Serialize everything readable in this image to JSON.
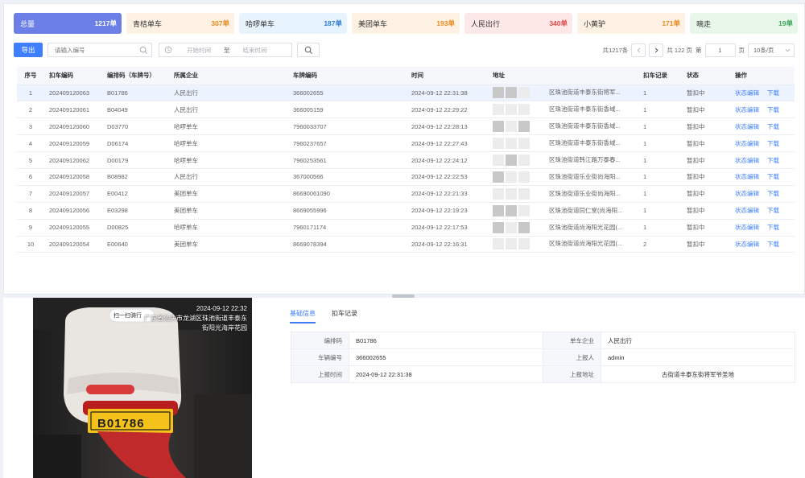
{
  "stats": [
    {
      "label": "总量",
      "count": "1217单",
      "bg": "#6b7fe6",
      "fg": "#ffffff"
    },
    {
      "label": "青桔单车",
      "count": "307单",
      "bg": "#fdf1e4",
      "fg": "#e88a1e"
    },
    {
      "label": "哈啰单车",
      "count": "187单",
      "bg": "#e7f3fd",
      "fg": "#2e7dd6"
    },
    {
      "label": "美团单车",
      "count": "193单",
      "bg": "#fdf1e4",
      "fg": "#e88a1e"
    },
    {
      "label": "人民出行",
      "count": "340单",
      "bg": "#fde8e8",
      "fg": "#e24949"
    },
    {
      "label": "小黄驴",
      "count": "171单",
      "bg": "#fdf1e4",
      "fg": "#e88a1e"
    },
    {
      "label": "嘀走",
      "count": "19单",
      "bg": "#e8f7ea",
      "fg": "#3aa55a"
    }
  ],
  "toolbar": {
    "export_label": "导出",
    "search_placeholder": "请输入编号",
    "date_start": "开始时间",
    "date_sep": "至",
    "date_end": "结束时间"
  },
  "pagination": {
    "total": "共1217条",
    "pages": "共 122 页",
    "goto": "第",
    "page": "1",
    "page_unit": "页",
    "page_size": "10条/页"
  },
  "table": {
    "headers": [
      "序号",
      "扣车编码",
      "编排码（车牌号）",
      "所属企业",
      "车牌编码",
      "时间",
      "地址",
      "扣车记录",
      "状态",
      "操作"
    ],
    "op_edit": "状态编辑",
    "op_download": "下载",
    "rows": [
      {
        "no": "1",
        "code": "202409120063",
        "plate": "B01786",
        "company": "人民出行",
        "bike": "366002655",
        "time": "2024-09-12 22:31:38",
        "addr": "区珠池街道丰泰东街将军...",
        "rec": "1",
        "status": "暂扣中"
      },
      {
        "no": "2",
        "code": "202409120061",
        "plate": "B04049",
        "company": "人民出行",
        "bike": "366005159",
        "time": "2024-09-12 22:29:22",
        "addr": "区珠池街道丰泰东街香域...",
        "rec": "1",
        "status": "暂扣中"
      },
      {
        "no": "3",
        "code": "202409120060",
        "plate": "D03770",
        "company": "哈啰单车",
        "bike": "7960033707",
        "time": "2024-09-12 22:28:13",
        "addr": "区珠池街道丰泰东街香域...",
        "rec": "1",
        "status": "暂扣中"
      },
      {
        "no": "4",
        "code": "202409120059",
        "plate": "D06174",
        "company": "哈啰单车",
        "bike": "7960237657",
        "time": "2024-09-12 22:27:43",
        "addr": "区珠池街道丰泰东街香域...",
        "rec": "1",
        "status": "暂扣中"
      },
      {
        "no": "5",
        "code": "202409120062",
        "plate": "D00179",
        "company": "哈啰单车",
        "bike": "7960253561",
        "time": "2024-09-12 22:24:12",
        "addr": "区珠池街道韩江路万泰春...",
        "rec": "1",
        "status": "暂扣中"
      },
      {
        "no": "6",
        "code": "202409120058",
        "plate": "B08982",
        "company": "人民出行",
        "bike": "367000566",
        "time": "2024-09-12 22:22:53",
        "addr": "区珠池街道乐业街尚海阳...",
        "rec": "1",
        "status": "暂扣中"
      },
      {
        "no": "7",
        "code": "202409120057",
        "plate": "E00412",
        "company": "美团单车",
        "bike": "86690061090",
        "time": "2024-09-12 22:21:33",
        "addr": "区珠池街道乐业街尚海阳...",
        "rec": "1",
        "status": "暂扣中"
      },
      {
        "no": "8",
        "code": "202409120056",
        "plate": "E03298",
        "company": "美团单车",
        "bike": "8669055996",
        "time": "2024-09-12 22:19:23",
        "addr": "区珠池街道同仁堂(尚海阳...",
        "rec": "1",
        "status": "暂扣中"
      },
      {
        "no": "9",
        "code": "202409120055",
        "plate": "D00825",
        "company": "哈啰单车",
        "bike": "7960171174",
        "time": "2024-09-12 22:17:53",
        "addr": "区珠池街道尚海阳光花园(...",
        "rec": "1",
        "status": "暂扣中"
      },
      {
        "no": "10",
        "code": "202409120054",
        "plate": "E00640",
        "company": "美团单车",
        "bike": "8669078394",
        "time": "2024-09-12 22:16:31",
        "addr": "区珠池街道尚海阳光花园(...",
        "rec": "2",
        "status": "暂扣中"
      }
    ]
  },
  "photo": {
    "stamp_time": "2024-09-12 22:32",
    "stamp_line1": "广东省汕头市龙湖区珠池街道丰泰东",
    "stamp_line2": "街阳光海岸花园",
    "badge_text": "扫一扫骑行",
    "plate_text": "B01786"
  },
  "detail": {
    "tabs": [
      "基础信息",
      "扣车记录"
    ],
    "rows": [
      {
        "k1": "编排码",
        "v1": "B01786",
        "k2": "单车企业",
        "v2": "人民出行"
      },
      {
        "k1": "车辆编号",
        "v1": "366002655",
        "k2": "上报人",
        "v2": "admin"
      },
      {
        "k1": "上报时间",
        "v1": "2024-09-12 22:31:38",
        "k2": "上报地址",
        "v2": "古街道丰泰东街将军爷圣地"
      }
    ]
  }
}
